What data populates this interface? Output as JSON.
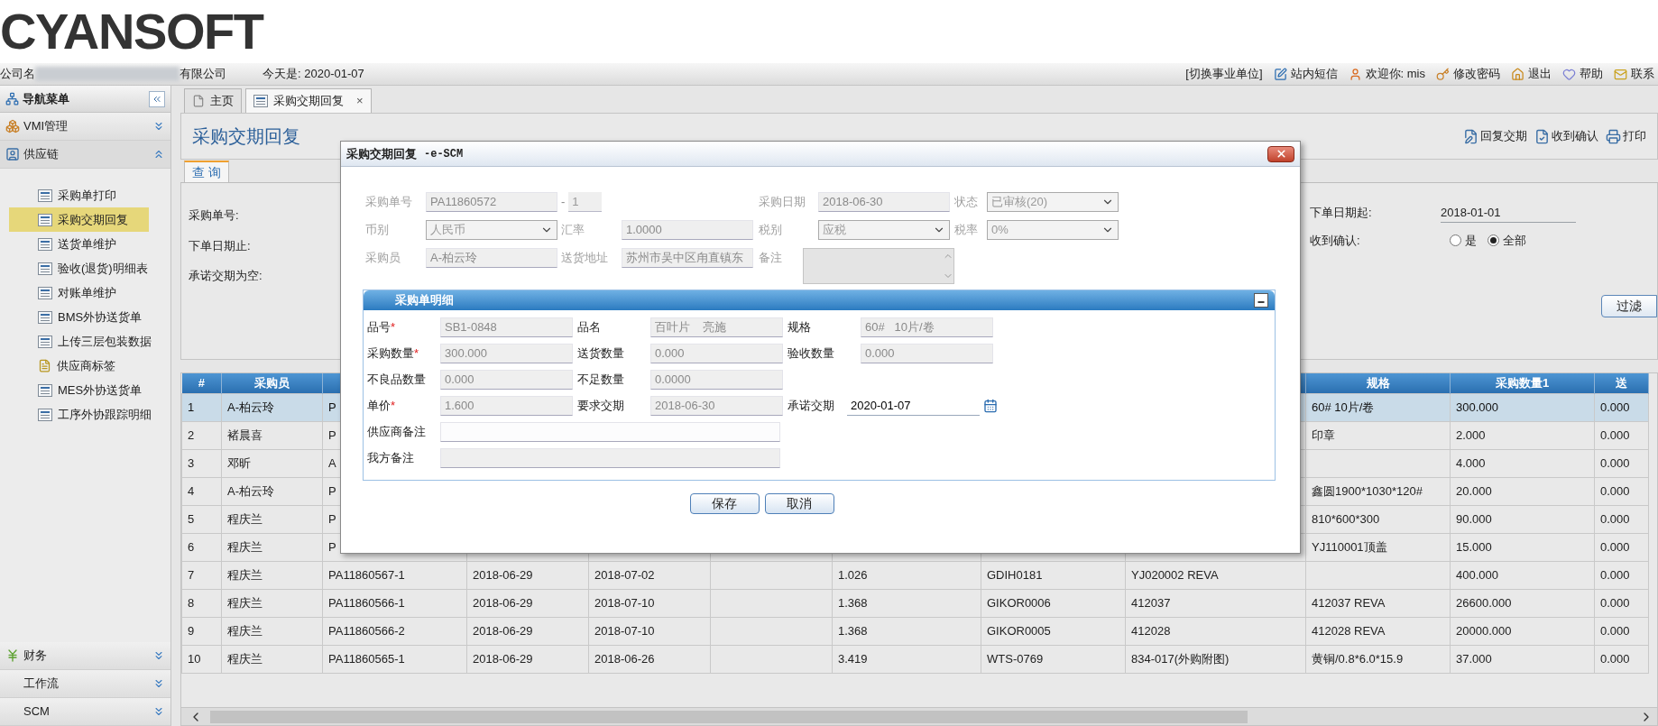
{
  "logo": {
    "text": "CYANSOFT"
  },
  "header": {
    "company_prefix": "公司名",
    "company_suffix": "有限公司",
    "today": "今天是: 2020-01-07",
    "links": [
      {
        "label": "[切换事业单位]"
      },
      {
        "label": "站内短信"
      },
      {
        "label": "欢迎你: mis"
      },
      {
        "label": "修改密码"
      },
      {
        "label": "退出"
      },
      {
        "label": "帮助"
      },
      {
        "label": "联系"
      }
    ]
  },
  "sidebar": {
    "title": "导航菜单",
    "groups": [
      {
        "label": "VMI管理",
        "expanded": false
      },
      {
        "label": "供应链",
        "expanded": true,
        "children": [
          {
            "label": "采购单打印",
            "kind": "form",
            "selected": false
          },
          {
            "label": "采购交期回复",
            "kind": "form",
            "selected": true
          },
          {
            "label": "送货单维护",
            "kind": "form",
            "selected": false
          },
          {
            "label": "验收(退货)明细表",
            "kind": "form",
            "selected": false
          },
          {
            "label": "对账单维护",
            "kind": "form",
            "selected": false
          },
          {
            "label": "BMS外协送货单",
            "kind": "form",
            "selected": false
          },
          {
            "label": "上传三层包装数据",
            "kind": "form",
            "selected": false
          },
          {
            "label": "供应商标签",
            "kind": "doc",
            "selected": false
          },
          {
            "label": "MES外协送货单",
            "kind": "form",
            "selected": false
          },
          {
            "label": "工序外协跟踪明细",
            "kind": "form",
            "selected": false
          }
        ]
      },
      {
        "label": "财务",
        "expanded": false
      },
      {
        "label": "工作流",
        "expanded": false
      },
      {
        "label": "SCM",
        "expanded": false
      }
    ]
  },
  "tabs": [
    {
      "label": "主页",
      "selected": false
    },
    {
      "label": "采购交期回复",
      "selected": true,
      "close_glyph": "×"
    }
  ],
  "panel": {
    "title": "采购交期回复",
    "toolbar": [
      {
        "label": "回复交期"
      },
      {
        "label": "收到确认"
      },
      {
        "label": "打印"
      }
    ]
  },
  "query": {
    "tab": "查 询",
    "left_labels": [
      "采购单号:",
      "下单日期止:",
      "承诺交期为空:"
    ],
    "date_from": {
      "label": "下单日期起:",
      "value": "2018-01-01"
    },
    "received": {
      "label": "收到确认:",
      "options": [
        {
          "label": "是",
          "selected": false
        },
        {
          "label": "全部",
          "selected": true
        }
      ]
    },
    "filter_button": "过滤"
  },
  "table": {
    "columns": [
      "#",
      "采购员",
      null,
      null,
      null,
      null,
      null,
      null,
      null,
      "规格",
      "采购数量1",
      "送"
    ],
    "rows": [
      {
        "selected": true,
        "cells": [
          "1",
          "A-柏云玲",
          "P",
          null,
          null,
          null,
          null,
          null,
          null,
          "60# 10片/卷",
          "300.000",
          "0.000"
        ]
      },
      {
        "selected": false,
        "cells": [
          "2",
          "褚晨喜",
          "P",
          null,
          null,
          null,
          null,
          null,
          null,
          "印章",
          "2.000",
          "0.000"
        ]
      },
      {
        "selected": false,
        "cells": [
          "3",
          "邓昕",
          "A",
          null,
          null,
          null,
          null,
          null,
          null,
          null,
          "4.000",
          "0.000"
        ]
      },
      {
        "selected": false,
        "cells": [
          "4",
          "A-柏云玲",
          "P",
          null,
          null,
          null,
          null,
          null,
          null,
          "鑫圆1900*1030*120#",
          "20.000",
          "0.000"
        ]
      },
      {
        "selected": false,
        "cells": [
          "5",
          "程庆兰",
          "P",
          null,
          null,
          null,
          null,
          null,
          null,
          "810*600*300",
          "90.000",
          "0.000"
        ]
      },
      {
        "selected": false,
        "cells": [
          "6",
          "程庆兰",
          "P",
          null,
          null,
          null,
          null,
          null,
          null,
          "YJ110001顶盖",
          "15.000",
          "0.000"
        ]
      },
      {
        "selected": false,
        "cells": [
          "7",
          "程庆兰",
          "PA11860567-1",
          "2018-06-29",
          "2018-07-02",
          null,
          "1.026",
          "GDIH0181",
          "YJ020002 REVA",
          null,
          "400.000",
          "0.000"
        ]
      },
      {
        "selected": false,
        "cells": [
          "8",
          "程庆兰",
          "PA11860566-1",
          "2018-06-29",
          "2018-07-10",
          null,
          "1.368",
          "GIKOR0006",
          "412037",
          "412037 REVA",
          "26600.000",
          "0.000"
        ]
      },
      {
        "selected": false,
        "cells": [
          "9",
          "程庆兰",
          "PA11860566-2",
          "2018-06-29",
          "2018-07-10",
          null,
          "1.368",
          "GIKOR0005",
          "412028",
          "412028 REVA",
          "20000.000",
          "0.000"
        ]
      },
      {
        "selected": false,
        "cells": [
          "10",
          "程庆兰",
          "PA11860565-1",
          "2018-06-29",
          "2018-06-26",
          null,
          "3.419",
          "WTS-0769",
          "834-017(外购附图)",
          "黄铜/0.8*6.0*15.9",
          "37.000",
          "0.000"
        ]
      }
    ]
  },
  "dialog": {
    "title": "采购交期回复",
    "title_suffix": "-e-SCM",
    "header_rows": [
      [
        {
          "label": "采购单号",
          "value": "PA11860572",
          "kind": "text",
          "disabled": true,
          "sub_sep": "-",
          "sub_value": "1"
        },
        {
          "label": "采购日期",
          "value": "2018-06-30",
          "kind": "text",
          "disabled": true
        },
        {
          "label": "状态",
          "value": "已审核(20)",
          "kind": "select",
          "disabled": true
        }
      ],
      [
        {
          "label": "币别",
          "value": "人民币",
          "kind": "select",
          "disabled": true
        },
        {
          "label": "汇率",
          "value": "1.0000",
          "kind": "text",
          "disabled": true
        },
        {
          "label": "税别",
          "value": "应税",
          "kind": "select",
          "disabled": true
        },
        {
          "label": "税率",
          "value": "0%",
          "kind": "select",
          "disabled": true
        }
      ],
      [
        {
          "label": "采购员",
          "value": "A-柏云玲",
          "kind": "text",
          "disabled": true
        },
        {
          "label": "送货地址",
          "value": "苏州市吴中区甪直镇东",
          "kind": "text",
          "disabled": true
        },
        {
          "label": "备注",
          "kind": "textarea",
          "disabled": true
        }
      ]
    ],
    "detail": {
      "title": "采购单明细",
      "rows": [
        [
          {
            "label": "品号",
            "required_mark": "*",
            "value": "SB1-0848",
            "kind": "text",
            "disabled": true
          },
          {
            "label": "品名",
            "value": "百叶片    亮施",
            "kind": "text",
            "disabled": true
          },
          {
            "label": "规格",
            "value": "60#   10片/卷",
            "kind": "text",
            "disabled": true
          }
        ],
        [
          {
            "label": "采购数量",
            "required_mark": "*",
            "value": "300.000",
            "kind": "text",
            "disabled": true
          },
          {
            "label": "送货数量",
            "value": "0.000",
            "kind": "text",
            "disabled": true
          },
          {
            "label": "验收数量",
            "value": "0.000",
            "kind": "text",
            "disabled": true
          }
        ],
        [
          {
            "label": "不良品数量",
            "value": "0.000",
            "kind": "text",
            "disabled": true
          },
          {
            "label": "不足数量",
            "value": "0.0000",
            "kind": "text",
            "disabled": true
          }
        ],
        [
          {
            "label": "单价",
            "required_mark": "*",
            "value": "1.600",
            "kind": "text",
            "disabled": true
          },
          {
            "label": "要求交期",
            "value": "2018-06-30",
            "kind": "text",
            "disabled": true
          },
          {
            "label": "承诺交期",
            "value": "2020-01-07",
            "kind": "date",
            "disabled": false
          }
        ],
        [
          {
            "label": "供应商备注",
            "kind": "wide",
            "disabled": false
          }
        ],
        [
          {
            "label": "我方备注",
            "kind": "wide",
            "disabled": true
          }
        ]
      ]
    },
    "buttons": [
      "保存",
      "取消"
    ]
  }
}
